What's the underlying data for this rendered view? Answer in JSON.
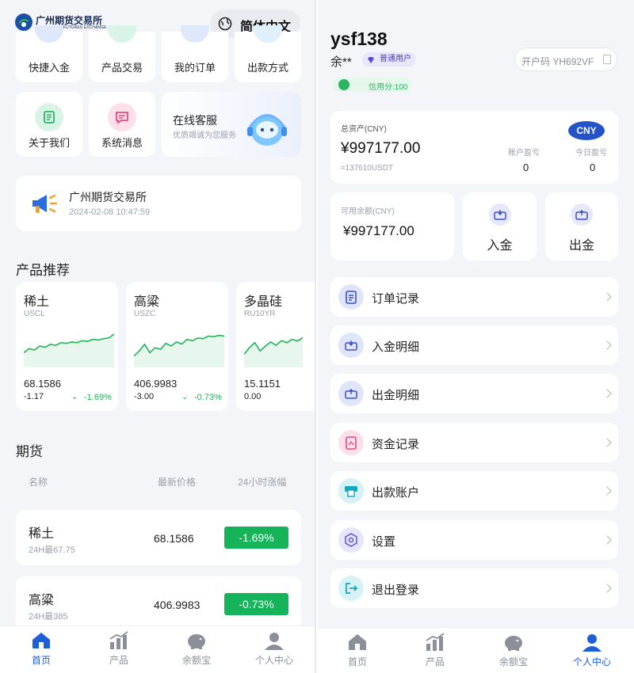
{
  "left": {
    "logo": {
      "name": "广州期货交易所",
      "sub": "GUANGZHOU FUTURES EXCHANGE"
    },
    "lang_label": "简体中文",
    "quick_menu": [
      {
        "label": "快捷入金",
        "icon": "deposit-icon",
        "color": "#dfe8fb"
      },
      {
        "label": "产品交易",
        "icon": "trade-icon",
        "color": "#d9f4e6"
      },
      {
        "label": "我的订单",
        "icon": "orders-icon",
        "color": "#dfe8fb"
      },
      {
        "label": "出款方式",
        "icon": "withdraw-method-icon",
        "color": "#dff0fb"
      },
      {
        "label": "关于我们",
        "icon": "about-icon",
        "color": "#d9f4e6"
      },
      {
        "label": "系统消息",
        "icon": "message-icon",
        "color": "#fde0ea"
      }
    ],
    "service": {
      "title": "在线客服",
      "subtitle": "优质竭诚为您服务"
    },
    "notice": {
      "title": "广州期货交易所",
      "time": "2024-02-08 10:47:59"
    },
    "recommend_title": "产品推荐",
    "products": [
      {
        "name": "稀土",
        "code": "USCL",
        "price": "68.1586",
        "change": "-1.17",
        "pct": "-1.69%",
        "spark": [
          0.3,
          0.42,
          0.38,
          0.5,
          0.46,
          0.55,
          0.52,
          0.6,
          0.58,
          0.62,
          0.6,
          0.66,
          0.64,
          0.7,
          0.68,
          0.72,
          0.74,
          0.86
        ]
      },
      {
        "name": "高粱",
        "code": "USZC",
        "price": "406.9983",
        "change": "-3.00",
        "pct": "-0.73%",
        "spark": [
          0.2,
          0.35,
          0.55,
          0.3,
          0.45,
          0.4,
          0.58,
          0.5,
          0.62,
          0.56,
          0.7,
          0.66,
          0.74,
          0.72,
          0.8,
          0.78,
          0.82,
          0.8
        ]
      },
      {
        "name": "多晶硅",
        "code": "RU10YR",
        "price": "15.1151",
        "change": "0.00",
        "pct": "",
        "spark": [
          0.25,
          0.45,
          0.6,
          0.35,
          0.5,
          0.62,
          0.52,
          0.66,
          0.6,
          0.7,
          0.65,
          0.75
        ]
      }
    ],
    "futures_title": "期货",
    "futures_headers": {
      "name": "名称",
      "price": "最新价格",
      "change": "24小时涨幅"
    },
    "futures": [
      {
        "name": "稀土",
        "sub": "24H最67.75",
        "price": "68.1586",
        "change": "-1.69%"
      },
      {
        "name": "高粱",
        "sub": "24H最385",
        "price": "406.9983",
        "change": "-0.73%"
      }
    ],
    "tabs": [
      {
        "label": "首页",
        "icon": "home-icon",
        "active": true
      },
      {
        "label": "产品",
        "icon": "chart-icon",
        "active": false
      },
      {
        "label": "余额宝",
        "icon": "piggy-bank-icon",
        "active": false
      },
      {
        "label": "个人中心",
        "icon": "user-icon",
        "active": false
      }
    ]
  },
  "right": {
    "username": "ysf138",
    "realname": "余**",
    "level": "普通用户",
    "credit": "信用分:100",
    "invite": "开户码 YH692VF",
    "assets": {
      "label": "总资产(CNY)",
      "badge": "CNY",
      "amount": "¥997177.00",
      "usdt": "≈137610USDT",
      "pl_label": "账户盈亏",
      "pl": "0",
      "today_label": "今日盈亏",
      "today": "0"
    },
    "available": {
      "label": "可用余额(CNY)",
      "amount": "¥997177.00"
    },
    "actions": {
      "deposit": "入金",
      "withdraw": "出金"
    },
    "menu": [
      {
        "label": "订单记录",
        "icon": "order-record-icon",
        "color": "#dfe6fb"
      },
      {
        "label": "入金明细",
        "icon": "deposit-detail-icon",
        "color": "#dfe6fb"
      },
      {
        "label": "出金明细",
        "icon": "withdraw-detail-icon",
        "color": "#dfe6fb"
      },
      {
        "label": "资金记录",
        "icon": "fund-record-icon",
        "color": "#fde0ea"
      },
      {
        "label": "出款账户",
        "icon": "payout-account-icon",
        "color": "#d6f2f6"
      },
      {
        "label": "设置",
        "icon": "settings-icon",
        "color": "#e6e6fb"
      },
      {
        "label": "退出登录",
        "icon": "logout-icon",
        "color": "#d6f2f6"
      }
    ],
    "tabs": [
      {
        "label": "首页",
        "icon": "home-icon",
        "active": false
      },
      {
        "label": "产品",
        "icon": "chart-icon",
        "active": false
      },
      {
        "label": "余额宝",
        "icon": "piggy-bank-icon",
        "active": false
      },
      {
        "label": "个人中心",
        "icon": "user-icon",
        "active": true
      }
    ]
  }
}
